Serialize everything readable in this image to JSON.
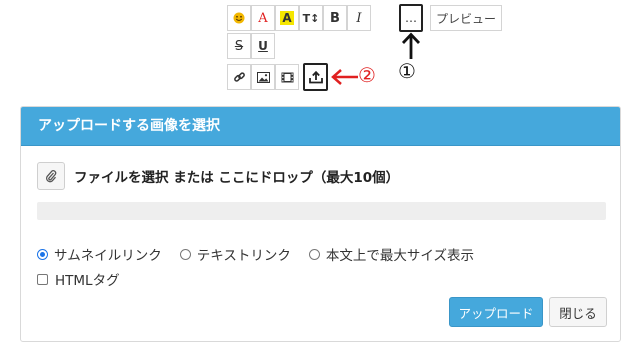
{
  "toolbar": {
    "row1": [
      {
        "name": "emoji-button",
        "glyph": "😄"
      },
      {
        "name": "font-color-button",
        "glyph": "A"
      },
      {
        "name": "highlight-button",
        "glyph": "A"
      },
      {
        "name": "font-size-button",
        "glyph": "T↕"
      },
      {
        "name": "bold-button",
        "glyph": "B"
      },
      {
        "name": "italic-button",
        "glyph": "I"
      }
    ],
    "row2": [
      {
        "name": "strikethrough-button",
        "glyph": "S"
      },
      {
        "name": "underline-button",
        "glyph": "U"
      }
    ],
    "row3": [
      {
        "name": "link-button"
      },
      {
        "name": "image-button"
      },
      {
        "name": "video-button"
      },
      {
        "name": "upload-button"
      }
    ],
    "more_label": "…",
    "preview_label": "プレビュー",
    "colors": {
      "font_color": "#e02020",
      "highlight": "#f5e600",
      "border": "#d4d4d4"
    }
  },
  "annotations": {
    "marker_1": "①",
    "marker_2": "②",
    "arrow_color": "#e02020"
  },
  "dialog": {
    "title": "アップロードする画像を選択",
    "header_color": "#45a8dc",
    "file_select_label": "ファイルを選択 または ここにドロップ（最大10個）",
    "progress_fraction": 0,
    "link_options": [
      {
        "label": "サムネイルリンク",
        "selected": true
      },
      {
        "label": "テキストリンク",
        "selected": false
      },
      {
        "label": "本文上で最大サイズ表示",
        "selected": false
      }
    ],
    "html_tag_label": "HTMLタグ",
    "html_tag_checked": false,
    "upload_button": "アップロード",
    "close_button": "閉じる"
  }
}
